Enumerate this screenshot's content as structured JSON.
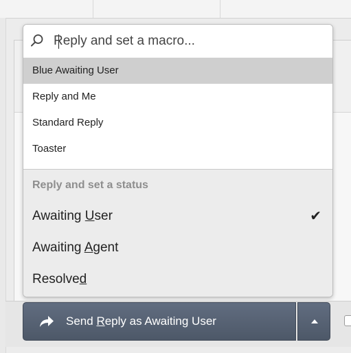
{
  "macro_search": {
    "placeholder": "Reply and set a macro..."
  },
  "macros": [
    {
      "label": "Blue Awaiting User",
      "selected": true
    },
    {
      "label": "Reply and Me",
      "selected": false
    },
    {
      "label": "Standard Reply",
      "selected": false
    },
    {
      "label": "Toaster",
      "selected": false
    }
  ],
  "status_section": {
    "header": "Reply and set a status",
    "items": [
      {
        "label_pre": "Awaiting ",
        "label_key": "U",
        "label_post": "ser",
        "checked": true
      },
      {
        "label_pre": "Awaiting ",
        "label_key": "A",
        "label_post": "gent",
        "checked": false
      },
      {
        "label_pre": "Resolve",
        "label_key": "d",
        "label_post": "",
        "checked": false
      }
    ]
  },
  "send_button": {
    "label_pre": "Send ",
    "label_key": "R",
    "label_post": "eply as Awaiting User"
  },
  "icons": {
    "search": "search-icon",
    "check": "check-icon",
    "reply": "reply-arrow-icon",
    "menu_toggle": "caret-up-icon"
  },
  "colors": {
    "button_bg": "#56616f",
    "selected_row": "#cfcfcf",
    "status_bg": "#ececec"
  }
}
